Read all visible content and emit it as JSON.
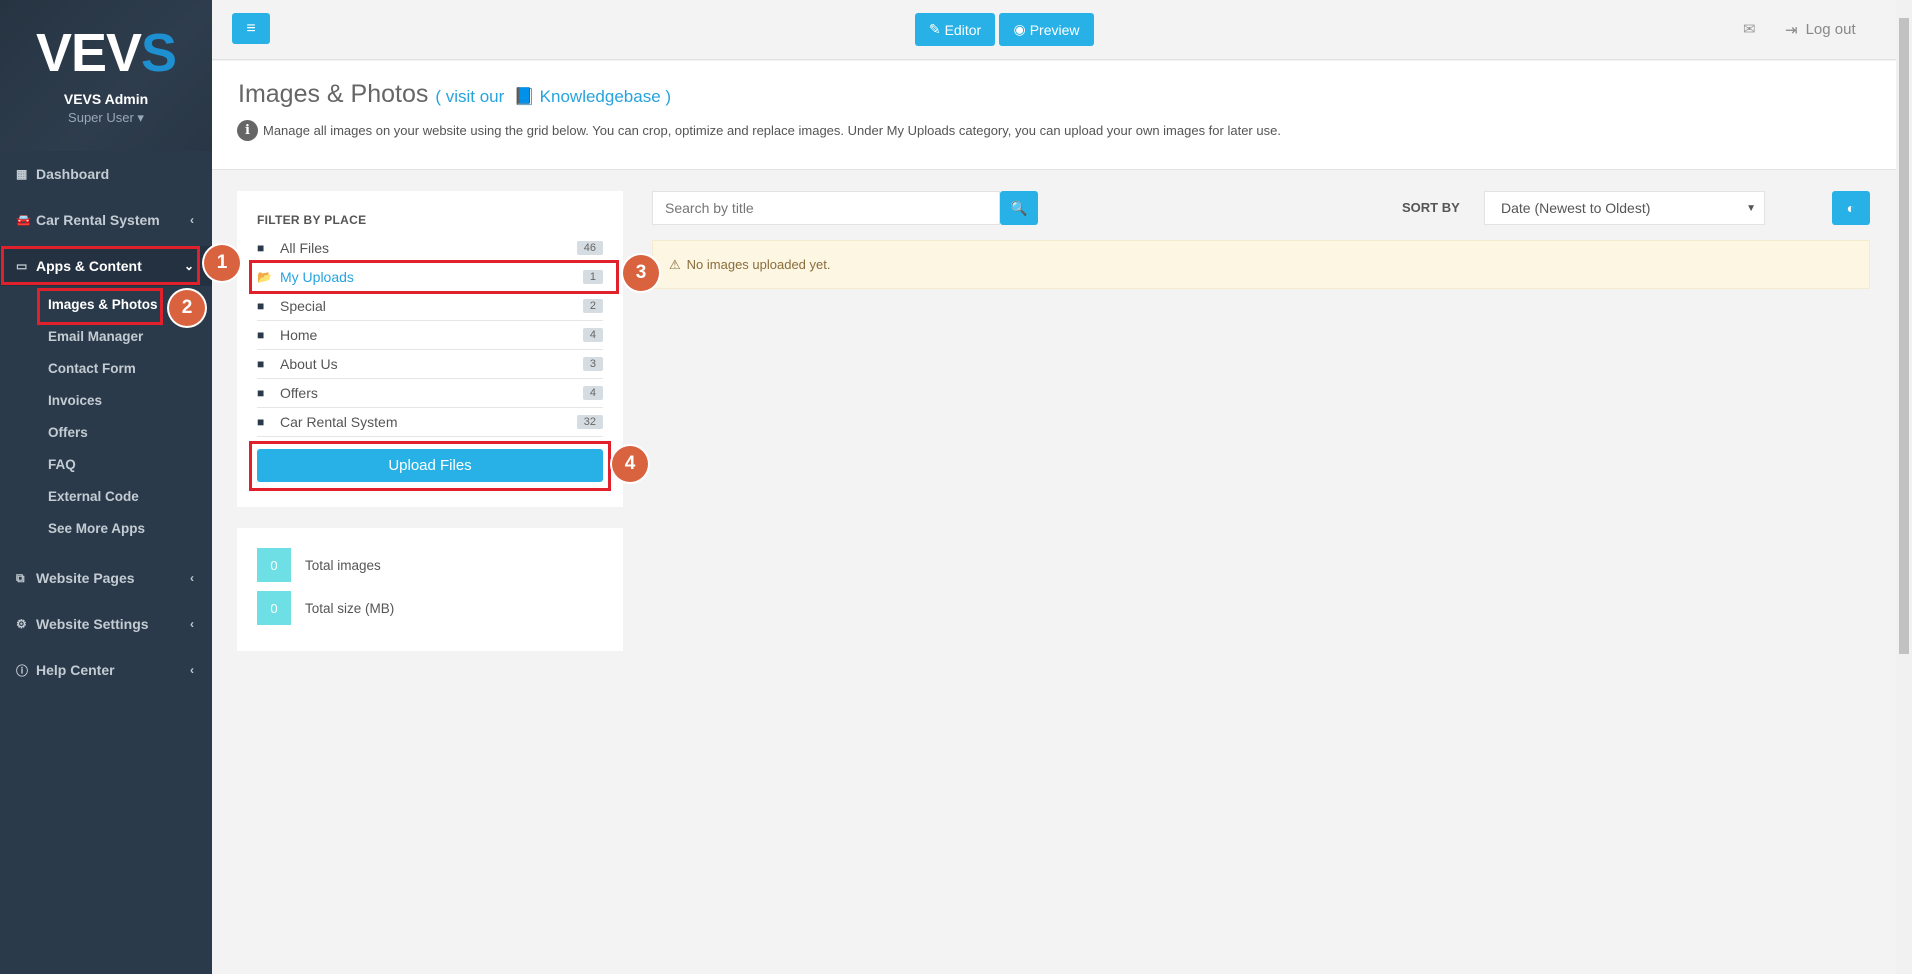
{
  "sidebar": {
    "logo": "VEVS",
    "user_name": "VEVS Admin",
    "user_role": "Super User",
    "items": [
      {
        "label": "Dashboard",
        "icon": "dashboard-icon"
      },
      {
        "label": "Car Rental System",
        "icon": "car-icon"
      },
      {
        "label": "Apps & Content",
        "icon": "monitor-icon"
      },
      {
        "label": "Website Pages",
        "icon": "pages-icon"
      },
      {
        "label": "Website Settings",
        "icon": "gears-icon"
      },
      {
        "label": "Help Center",
        "icon": "info-icon"
      }
    ],
    "subitems": [
      "Images & Photos",
      "Email Manager",
      "Contact Form",
      "Invoices",
      "Offers",
      "FAQ",
      "External Code",
      "See More Apps"
    ]
  },
  "topbar": {
    "editor": "Editor",
    "preview": "Preview",
    "logout": "Log out"
  },
  "header": {
    "title": "Images & Photos",
    "link_prefix": "( visit our",
    "link": "Knowledgebase )",
    "description": "Manage all images on your website using the grid below. You can crop, optimize and replace images. Under My Uploads category, you can upload your own images for later use."
  },
  "filter": {
    "heading": "FILTER BY PLACE",
    "items": [
      {
        "label": "All Files",
        "count": "46"
      },
      {
        "label": "My Uploads",
        "count": "1"
      },
      {
        "label": "Special",
        "count": "2"
      },
      {
        "label": "Home",
        "count": "4"
      },
      {
        "label": "About Us",
        "count": "3"
      },
      {
        "label": "Offers",
        "count": "4"
      },
      {
        "label": "Car Rental System",
        "count": "32"
      }
    ],
    "upload": "Upload Files"
  },
  "stats": [
    {
      "value": "0",
      "label": "Total images"
    },
    {
      "value": "0",
      "label": "Total size (MB)"
    }
  ],
  "search": {
    "placeholder": "Search by title"
  },
  "sort": {
    "label": "SORT BY",
    "value": "Date (Newest to Oldest)"
  },
  "alert": "No images uploaded yet.",
  "annotations": [
    "1",
    "2",
    "3",
    "4"
  ],
  "colors": {
    "accent": "#27b1e6",
    "sidebar": "#2b3a4a",
    "annotation": "#e0202a"
  }
}
